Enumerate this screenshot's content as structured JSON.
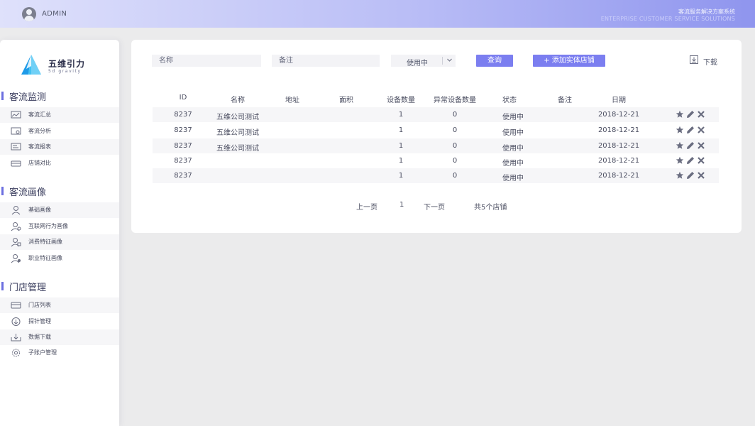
{
  "header": {
    "user": "ADMIN",
    "system_title": "客流服务解决方案系统",
    "system_subtitle": "ENTERPRISE CUSTOMER SERVICE SOLUTIONS"
  },
  "brand": {
    "name": "五维引力",
    "sub": "5d gravity",
    "accent": "#7b7ef0"
  },
  "sidebar": {
    "sections": [
      {
        "title": "客流监测",
        "items": [
          {
            "label": "客流汇总",
            "icon": "chart-icon"
          },
          {
            "label": "客流分析",
            "icon": "monitor-search-icon"
          },
          {
            "label": "客流报表",
            "icon": "report-icon"
          },
          {
            "label": "店铺对比",
            "icon": "compare-icon"
          }
        ]
      },
      {
        "title": "客流画像",
        "items": [
          {
            "label": "基础画像",
            "icon": "user-icon"
          },
          {
            "label": "互联网行为画像",
            "icon": "user-net-icon"
          },
          {
            "label": "消费特征画像",
            "icon": "user-consume-icon"
          },
          {
            "label": "职业特征画像",
            "icon": "user-job-icon"
          }
        ]
      },
      {
        "title": "门店管理",
        "items": [
          {
            "label": "门店列表",
            "icon": "store-list-icon"
          },
          {
            "label": "探针管理",
            "icon": "probe-icon"
          },
          {
            "label": "数据下载",
            "icon": "download-icon"
          },
          {
            "label": "子账户管理",
            "icon": "settings-icon"
          }
        ]
      }
    ]
  },
  "filters": {
    "name_placeholder": "名称",
    "note_placeholder": "备注",
    "status_value": "使用中",
    "query_label": "查询",
    "add_label": "+ 添加实体店铺",
    "download_label": "下载"
  },
  "table": {
    "columns": [
      "ID",
      "名称",
      "地址",
      "面积",
      "设备数量",
      "异常设备数量",
      "状态",
      "备注",
      "日期"
    ],
    "rows": [
      {
        "id": "8237",
        "name": "五维公司测试",
        "address": "",
        "area": "",
        "devices": "1",
        "abnormal": "0",
        "status": "使用中",
        "note": "",
        "date": "2018-12-21"
      },
      {
        "id": "8237",
        "name": "五维公司测试",
        "address": "",
        "area": "",
        "devices": "1",
        "abnormal": "0",
        "status": "使用中",
        "note": "",
        "date": "2018-12-21"
      },
      {
        "id": "8237",
        "name": "五维公司测试",
        "address": "",
        "area": "",
        "devices": "1",
        "abnormal": "0",
        "status": "使用中",
        "note": "",
        "date": "2018-12-21"
      },
      {
        "id": "8237",
        "name": "",
        "address": "",
        "area": "",
        "devices": "1",
        "abnormal": "0",
        "status": "使用中",
        "note": "",
        "date": "2018-12-21"
      },
      {
        "id": "8237",
        "name": "",
        "address": "",
        "area": "",
        "devices": "1",
        "abnormal": "0",
        "status": "使用中",
        "note": "",
        "date": "2018-12-21"
      }
    ]
  },
  "pagination": {
    "prev": "上一页",
    "current": "1",
    "next": "下一页",
    "total": "共5个店铺"
  }
}
